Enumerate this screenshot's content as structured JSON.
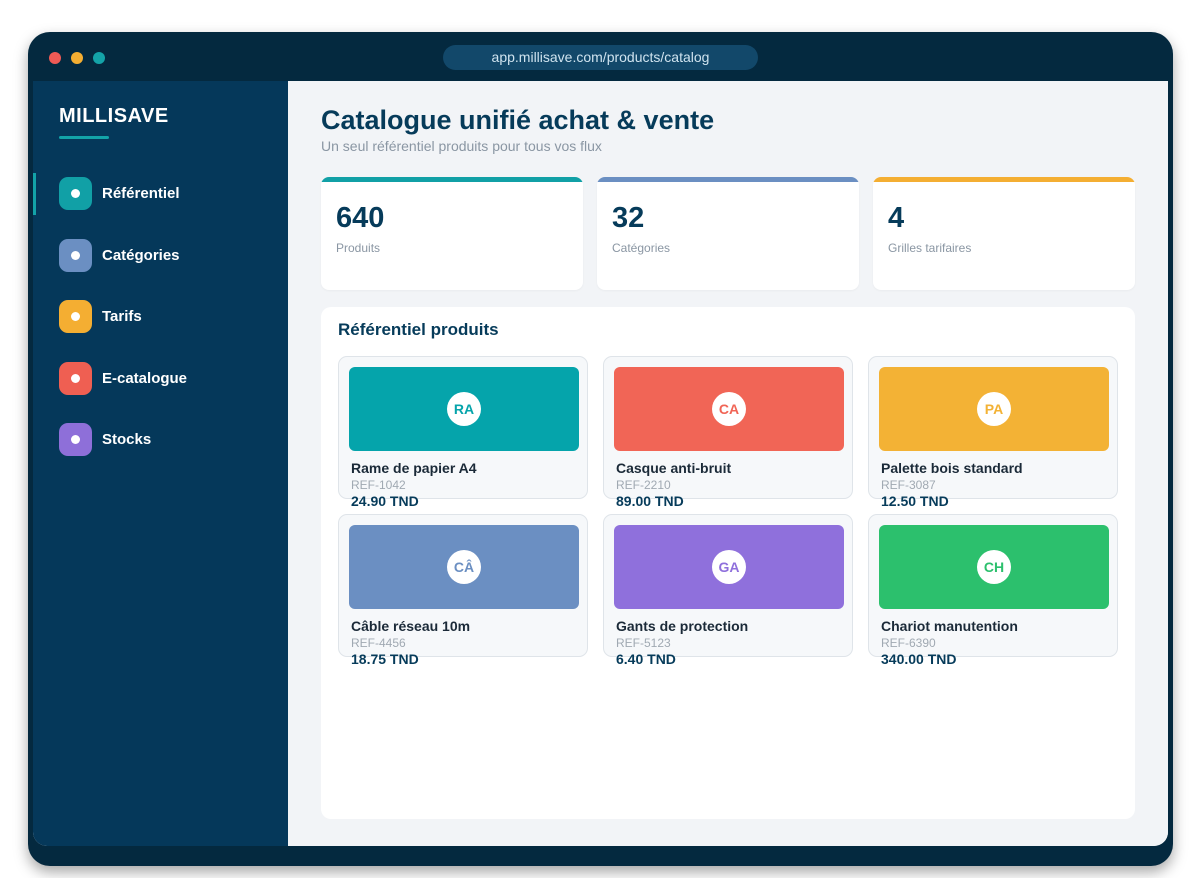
{
  "browser": {
    "url": "app.millisave.com/products/catalog",
    "dots": [
      "#f05a55",
      "#f4ae32",
      "#14a3a8"
    ]
  },
  "sidebar": {
    "brand": "MILLISAVE",
    "items": [
      {
        "label": "Référentiel",
        "color": "#11a0a6",
        "active": true,
        "icon": "dot-icon"
      },
      {
        "label": "Catégories",
        "color": "#6b8fc2",
        "active": false,
        "icon": "dot-icon"
      },
      {
        "label": "Tarifs",
        "color": "#f4ae32",
        "active": false,
        "icon": "dot-icon"
      },
      {
        "label": "E-catalogue",
        "color": "#ef5f52",
        "active": false,
        "icon": "dot-icon"
      },
      {
        "label": "Stocks",
        "color": "#8e6fd9",
        "active": false,
        "icon": "dot-icon"
      }
    ]
  },
  "header": {
    "title": "Catalogue unifié achat & vente",
    "subtitle": "Un seul référentiel produits pour tous vos flux"
  },
  "stats": [
    {
      "value": "640",
      "label": "Produits",
      "color": "#11a0a6"
    },
    {
      "value": "32",
      "label": "Catégories",
      "color": "#6b8fc2"
    },
    {
      "value": "4",
      "label": "Grilles tarifaires",
      "color": "#f4ae32"
    }
  ],
  "panel": {
    "title": "Référentiel produits",
    "products": [
      {
        "initials": "RA",
        "name": "Rame de papier A4",
        "ref": "REF-1042",
        "price": "24.90 TND",
        "color": "#05a4ab"
      },
      {
        "initials": "CA",
        "name": "Casque anti-bruit",
        "ref": "REF-2210",
        "price": "89.00 TND",
        "color": "#f16556"
      },
      {
        "initials": "PA",
        "name": "Palette bois standard",
        "ref": "REF-3087",
        "price": "12.50 TND",
        "color": "#f3b235"
      },
      {
        "initials": "CÂ",
        "name": "Câble réseau 10m",
        "ref": "REF-4456",
        "price": "18.75 TND",
        "color": "#6b8fc2"
      },
      {
        "initials": "GA",
        "name": "Gants de protection",
        "ref": "REF-5123",
        "price": "6.40 TND",
        "color": "#8f70dc"
      },
      {
        "initials": "CH",
        "name": "Chariot manutention",
        "ref": "REF-6390",
        "price": "340.00 TND",
        "color": "#2cc06d"
      }
    ]
  }
}
